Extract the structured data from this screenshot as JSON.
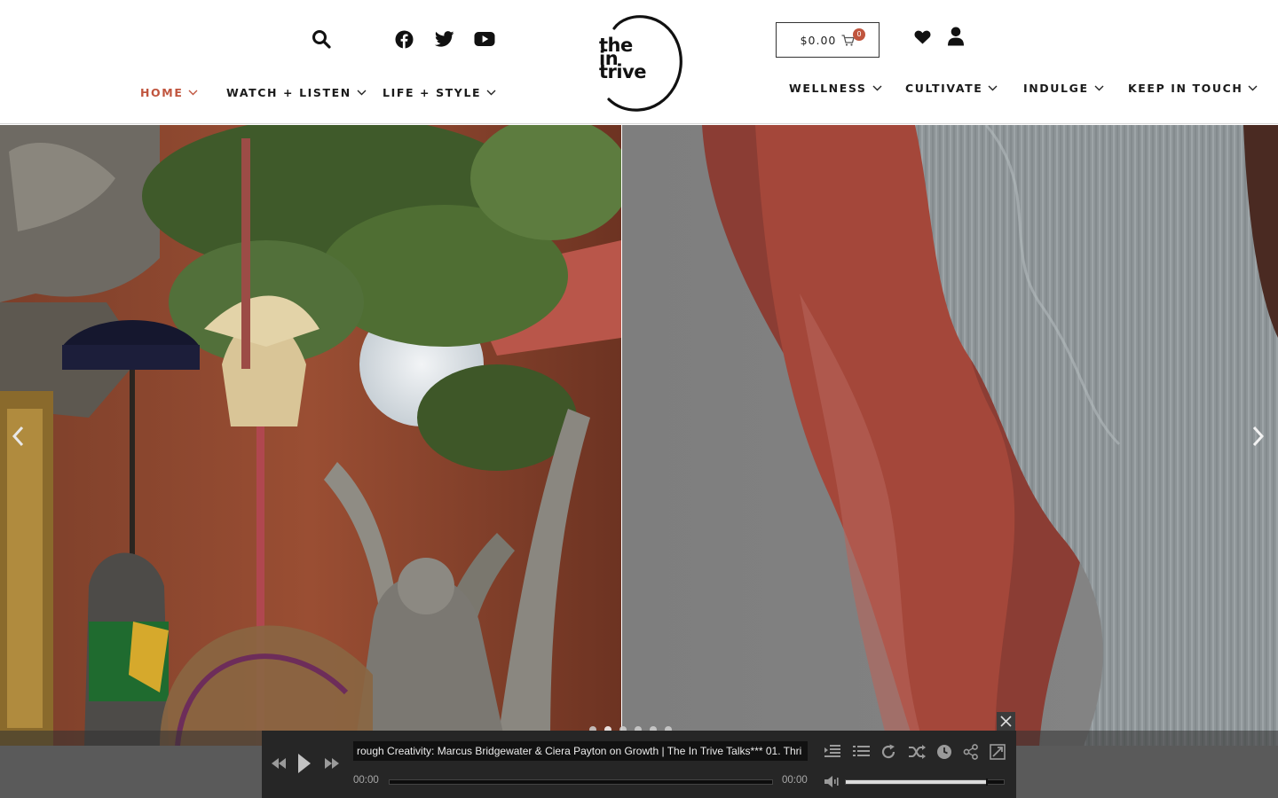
{
  "header": {
    "logo_text": [
      "the",
      "in",
      "trive"
    ],
    "cart": {
      "amount": "$0.00",
      "count": "0"
    },
    "nav_left": [
      {
        "label": "HOME",
        "active": true
      },
      {
        "label": "WATCH + LISTEN",
        "active": false
      },
      {
        "label": "LIFE + STYLE",
        "active": false
      }
    ],
    "nav_right": [
      {
        "label": "WELLNESS"
      },
      {
        "label": "CULTIVATE"
      },
      {
        "label": "INDULGE"
      },
      {
        "label": "KEEP IN TOUCH"
      }
    ],
    "icons": [
      "search-icon",
      "facebook-icon",
      "twitter-icon",
      "youtube-icon",
      "heart-icon",
      "user-icon",
      "cart-icon"
    ]
  },
  "slider": {
    "slides": [
      "temple-photo",
      "abstract-red-gray-art"
    ],
    "dot_count": 6,
    "active_dot": 1
  },
  "player": {
    "now_playing": "rough Creativity: Marcus Bridgewater & Ciera Payton on Growth | The In Trive Talks*** 01. Thri",
    "time_elapsed": "00:00",
    "time_total": "00:00",
    "volume": 0.9
  },
  "colors": {
    "accent": "#c0553e",
    "text": "#1a1a1a",
    "player_bg": "#262626"
  }
}
